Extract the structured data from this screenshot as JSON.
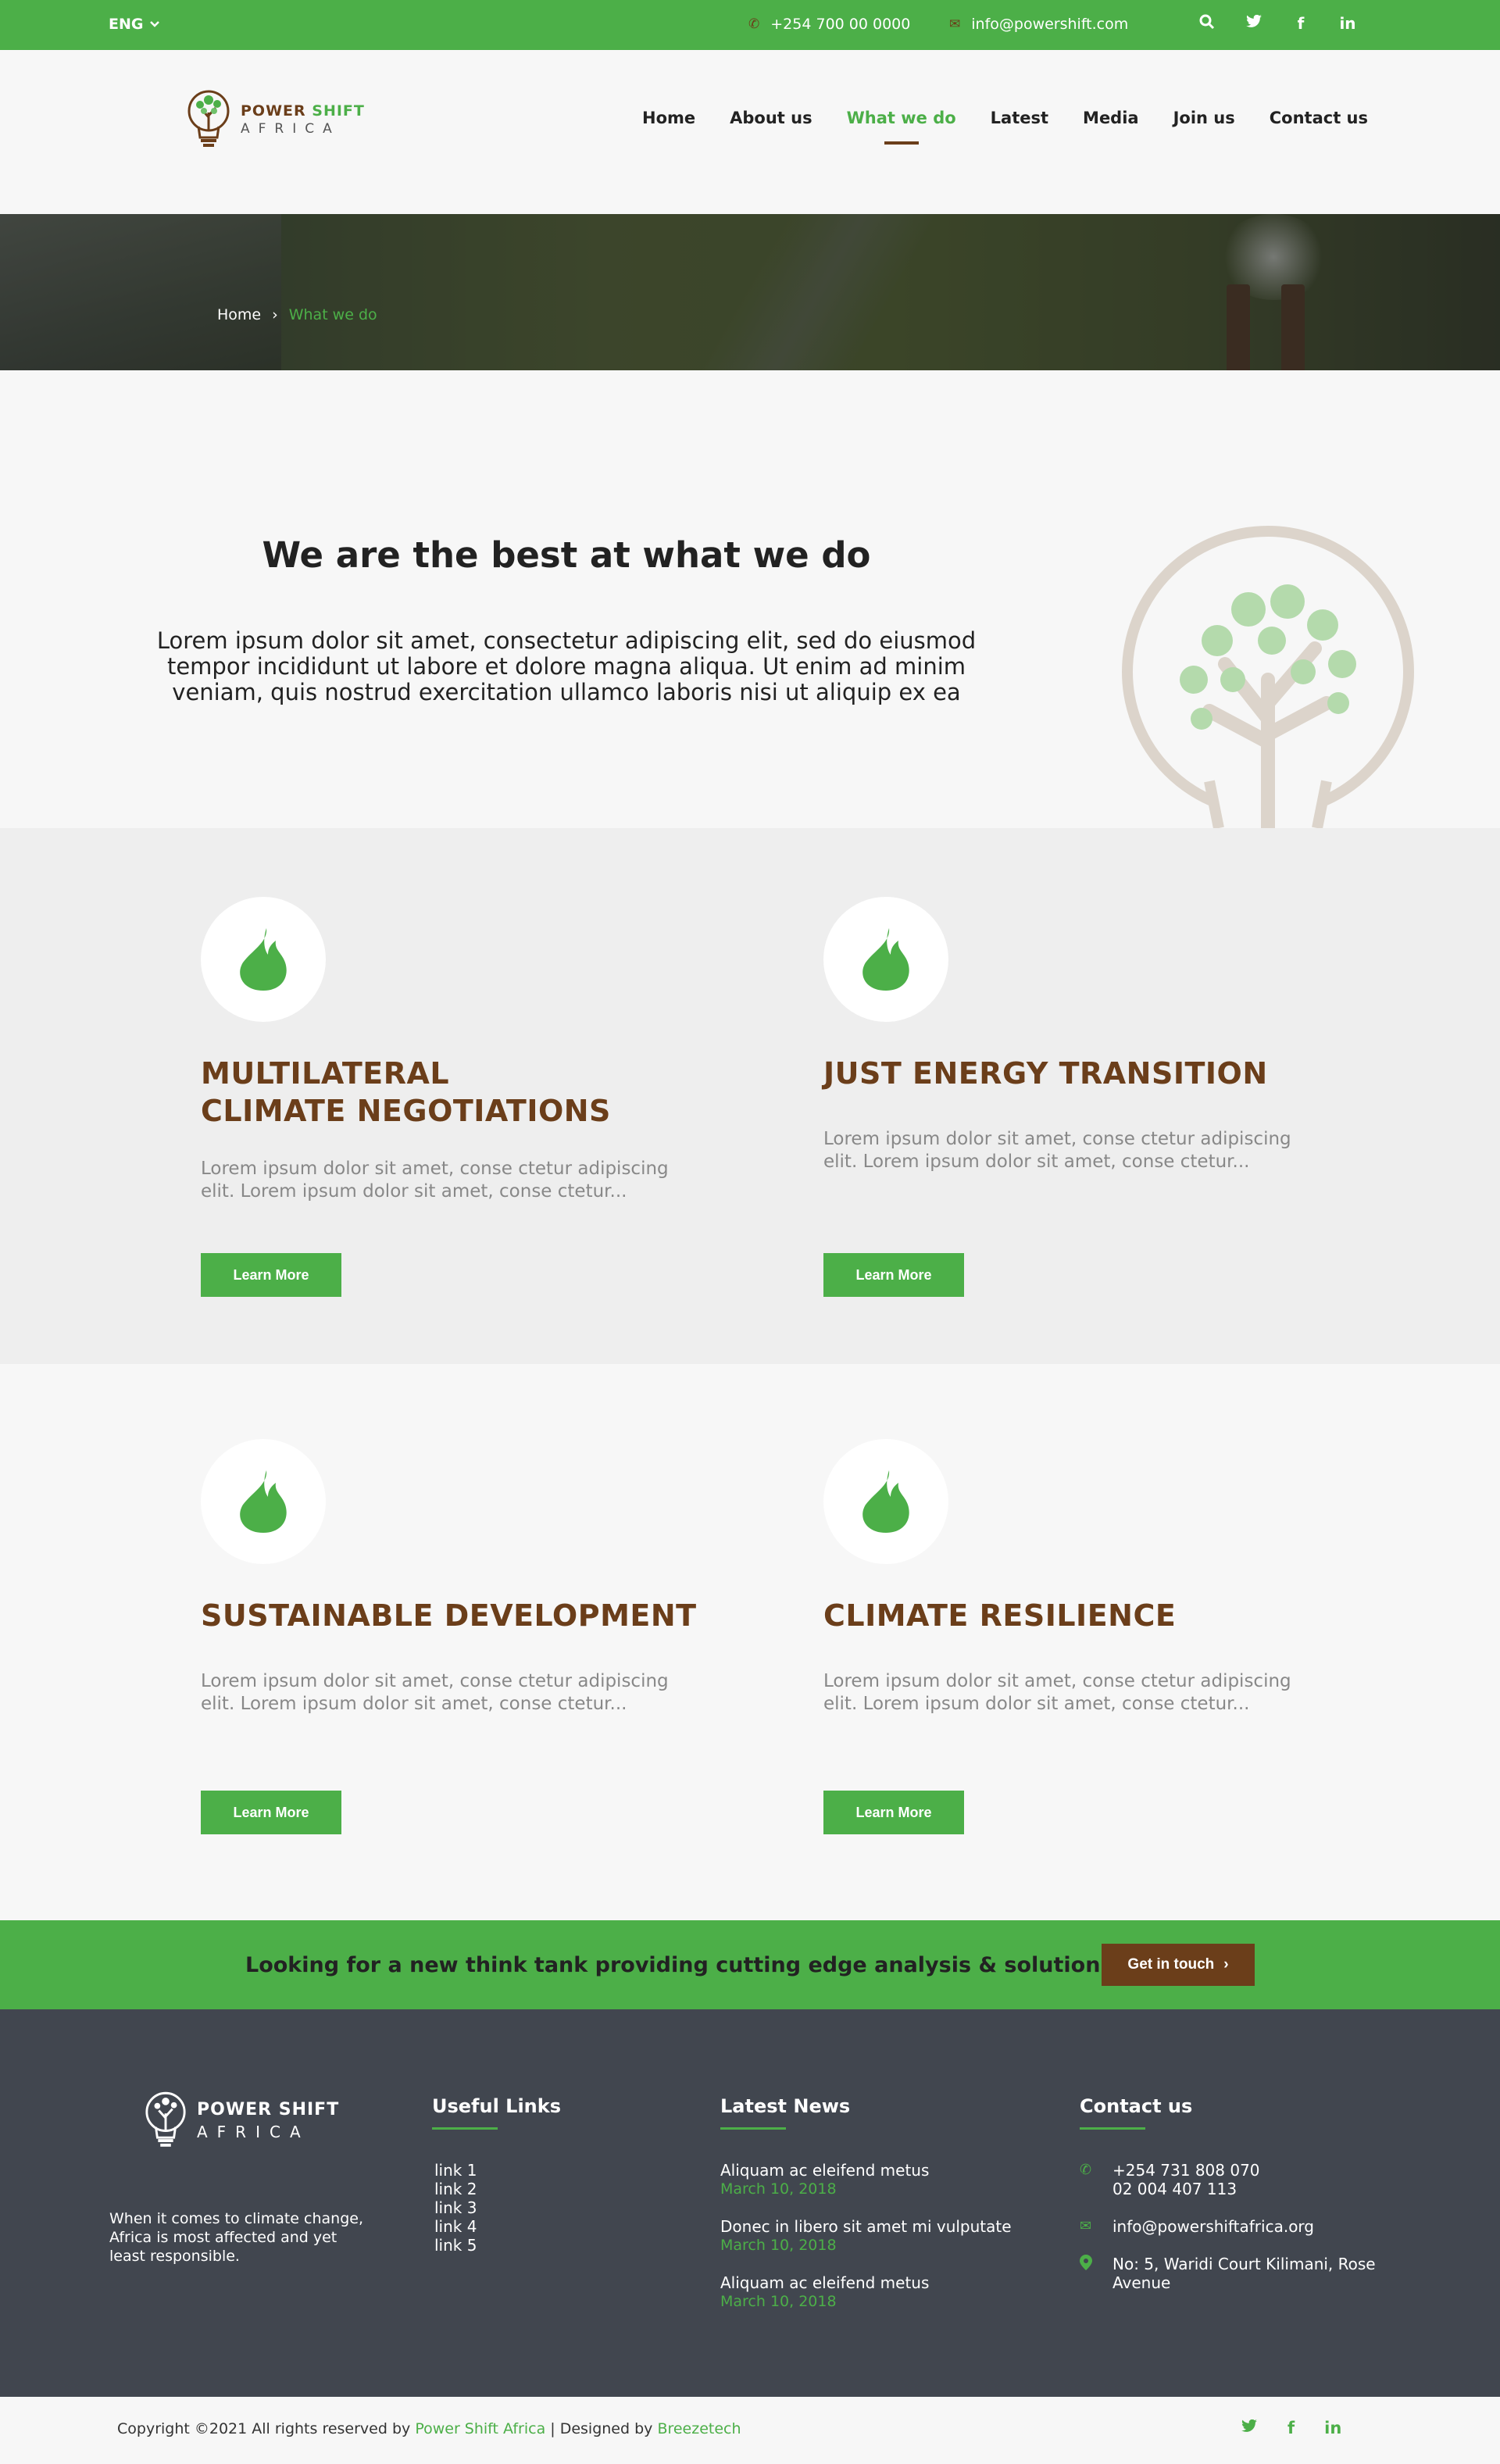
{
  "topbar": {
    "language": "ENG",
    "phone": "+254 700 00 0000",
    "email": "info@powershift.com",
    "icons": [
      "search-icon",
      "twitter-icon",
      "facebook-icon",
      "linkedin-icon"
    ]
  },
  "brand": {
    "name_part1": "POWER",
    "name_part2": "SHIFT",
    "name_line2": "AFRICA",
    "colors": {
      "green": "#4caf48",
      "brown": "#6b3e1a",
      "footer": "#41464f"
    }
  },
  "nav": {
    "items": [
      "Home",
      "About us",
      "What we do",
      "Latest",
      "Media",
      "Join us",
      "Contact us"
    ],
    "active": "What we do"
  },
  "breadcrumb": {
    "home": "Home",
    "separator": "›",
    "current": "What we do"
  },
  "intro": {
    "title": "We are the best at what we do",
    "body": "Lorem ipsum dolor sit amet, consectetur adipiscing elit, sed do eiusmod tempor incididunt ut labore et dolore magna aliqua. Ut enim ad minim veniam, quis nostrud exercitation ullamco laboris nisi ut aliquip ex ea"
  },
  "services": [
    {
      "title": "MULTILATERAL\nCLIMATE NEGOTIATIONS",
      "text": "Lorem ipsum dolor sit amet, conse ctetur adipiscing elit. Lorem ipsum dolor sit amet, conse ctetur...",
      "button": "Learn More",
      "icon": "flame-icon"
    },
    {
      "title": "JUST ENERGY TRANSITION",
      "text": "Lorem ipsum dolor sit amet, conse ctetur adipiscing elit. Lorem ipsum dolor sit amet, conse ctetur...",
      "button": "Learn More",
      "icon": "flame-icon"
    },
    {
      "title": "SUSTAINABLE DEVELOPMENT",
      "text": "Lorem ipsum dolor sit amet, conse ctetur adipiscing elit. Lorem ipsum dolor sit amet, conse ctetur...",
      "button": "Learn More",
      "icon": "flame-icon"
    },
    {
      "title": "CLIMATE RESILIENCE",
      "text": "Lorem ipsum dolor sit amet, conse ctetur adipiscing elit. Lorem ipsum dolor sit amet, conse ctetur...",
      "button": "Learn More",
      "icon": "flame-icon"
    }
  ],
  "cta": {
    "text": "Looking for a new think tank providing cutting edge analysis & solution ?",
    "button": "Get in touch"
  },
  "footer": {
    "tagline": "When it comes to climate change, Africa is most affected and yet least responsible.",
    "useful_links_title": "Useful Links",
    "links": [
      "link 1",
      "link 2",
      "link 3",
      "link 4",
      "link 5"
    ],
    "news_title": "Latest News",
    "news": [
      {
        "title": "Aliquam ac eleifend metus",
        "date": "March 10, 2018"
      },
      {
        "title": "Donec in libero sit amet mi vulputate",
        "date": "March 10, 2018"
      },
      {
        "title": "Aliquam ac eleifend metus",
        "date": "March 10, 2018"
      }
    ],
    "contact_title": "Contact us",
    "contact": {
      "phone1": "+254 731 808 070",
      "phone2": "02 004 407 113",
      "email": "info@powershiftafrica.org",
      "address": "No: 5, Waridi Court Kilimani, Rose Avenue"
    }
  },
  "bottom": {
    "copy_prefix": "Copyright ©2021 All rights reserved by ",
    "company": "Power Shift Africa",
    "designed_prefix": " | Designed by ",
    "designer": "Breezetech",
    "icons": [
      "twitter-icon",
      "facebook-icon",
      "linkedin-icon"
    ]
  }
}
